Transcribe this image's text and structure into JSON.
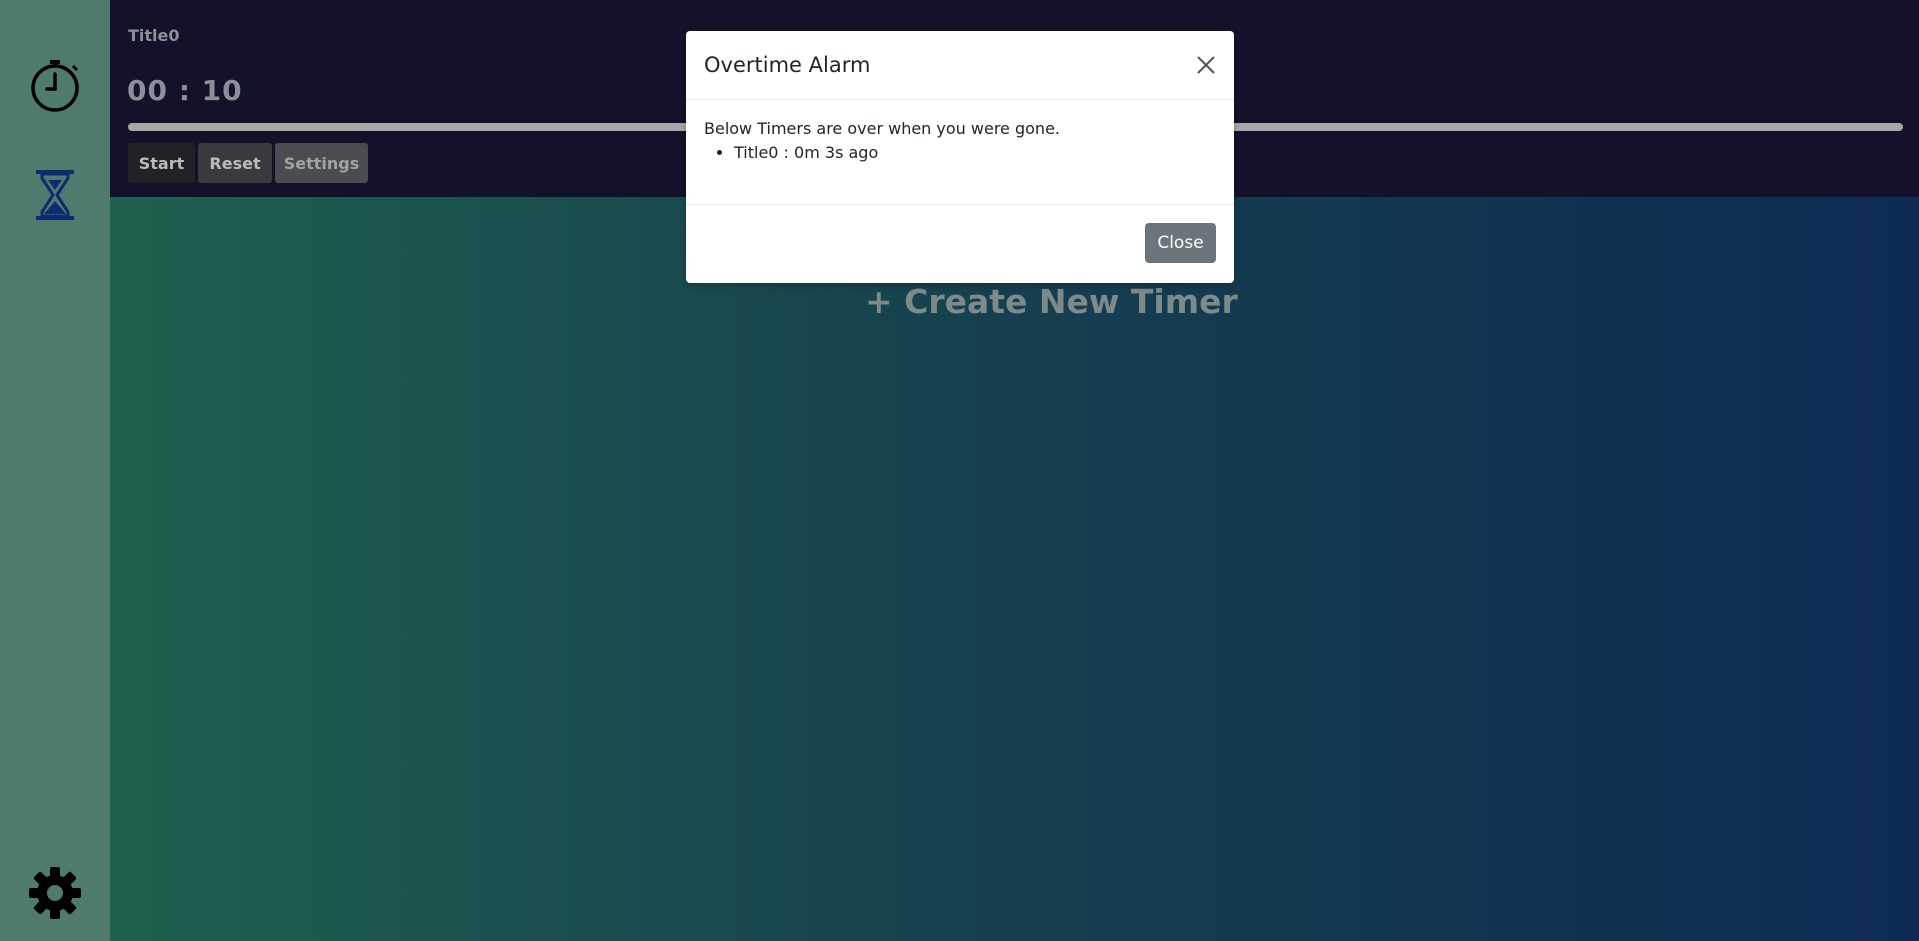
{
  "sidebar": {
    "items": [
      {
        "icon": "stopwatch-icon"
      },
      {
        "icon": "hourglass-icon"
      }
    ],
    "bottom_icon": "gear-icon"
  },
  "timer": {
    "title": "Title0",
    "time": "00 : 10",
    "buttons": {
      "start": "Start",
      "reset": "Reset",
      "settings": "Settings"
    }
  },
  "create_new": "+ Create New Timer",
  "modal": {
    "title": "Overtime Alarm",
    "message": "Below Timers are over when you were gone.",
    "items": [
      "Title0 : 0m 3s ago"
    ],
    "close_label": "Close"
  },
  "colors": {
    "sidebar_bg": "#4f7b6e",
    "timer_bg": "#13122a",
    "hourglass_blue": "#0d2b6e",
    "close_button": "#6c757d"
  }
}
